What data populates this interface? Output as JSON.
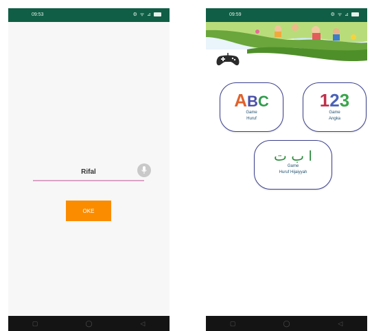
{
  "phone1": {
    "status_time": "09:53",
    "status_icons": "⚙ ᯤ ⊿",
    "name_value": "Rifal",
    "ok_label": "OKE",
    "nav": [
      "▢",
      "◯",
      "◁"
    ]
  },
  "phone2": {
    "status_time": "09:59",
    "status_icons": "⚙ ᯤ ⊿",
    "cards": {
      "huruf": {
        "logo_a": "A",
        "logo_b": "B",
        "logo_c": "C",
        "line1": "Game",
        "line2": "Huruf"
      },
      "angka": {
        "logo_1": "1",
        "logo_2": "2",
        "logo_3": "3",
        "line1": "Game",
        "line2": "Angka"
      },
      "hijaiyyah": {
        "logo": "ا ب ت",
        "line1": "Game",
        "line2": "Huruf Hijaiyyah"
      }
    },
    "nav": [
      "▢",
      "◯",
      "◁"
    ]
  },
  "colors": {
    "status_bar": "#0f5e45",
    "ok_button": "#fb8c00",
    "card_border": "#3a3f8c",
    "input_underline": "#d9a3c4"
  },
  "icons": {
    "mic": "microphone-icon",
    "gamepad": "gamepad-icon"
  }
}
